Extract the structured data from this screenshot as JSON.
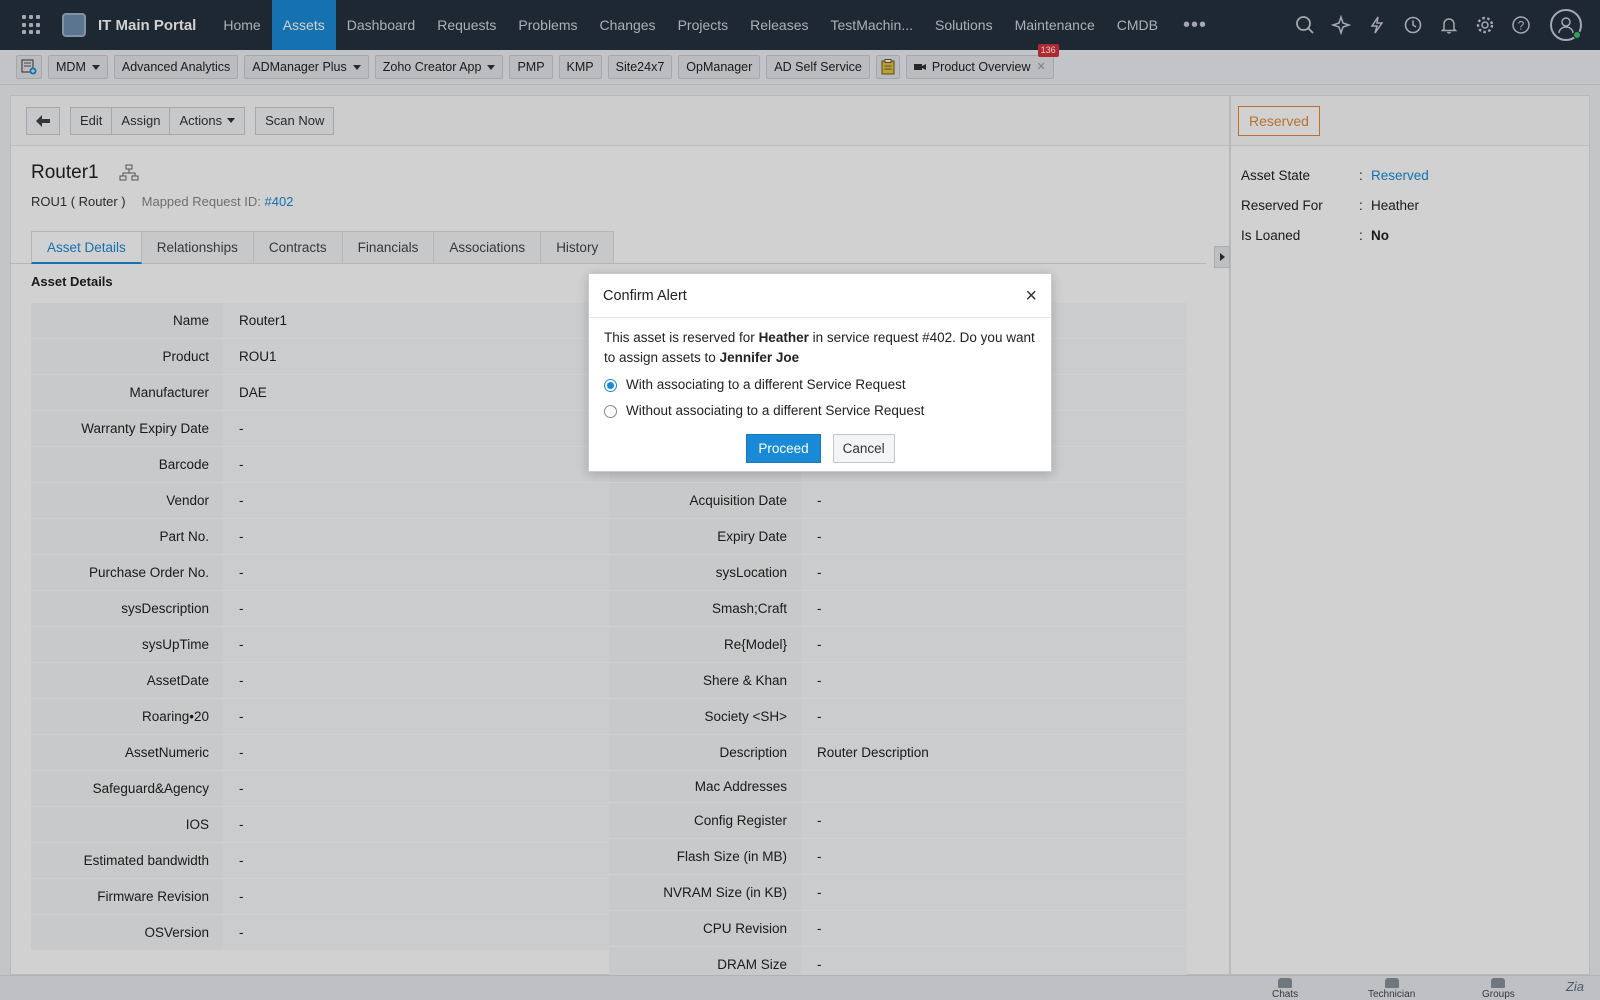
{
  "topnav": {
    "title": "IT Main Portal",
    "tabs": [
      {
        "label": "Home"
      },
      {
        "label": "Assets",
        "active": true
      },
      {
        "label": "Dashboard"
      },
      {
        "label": "Requests"
      },
      {
        "label": "Problems"
      },
      {
        "label": "Changes"
      },
      {
        "label": "Projects"
      },
      {
        "label": "Releases"
      },
      {
        "label": "TestMachin..."
      },
      {
        "label": "Solutions"
      },
      {
        "label": "Maintenance"
      },
      {
        "label": "CMDB"
      }
    ],
    "more": "•••",
    "icons": [
      "search-icon",
      "ai-sparkle-icon",
      "lightning-icon",
      "history-icon",
      "bell-icon",
      "gear-icon",
      "help-icon"
    ]
  },
  "toolbar": {
    "items": [
      {
        "label": "MDM",
        "dropdown": true
      },
      {
        "label": "Advanced Analytics"
      },
      {
        "label": "ADManager Plus",
        "dropdown": true
      },
      {
        "label": "Zoho Creator App",
        "dropdown": true
      },
      {
        "label": "PMP"
      },
      {
        "label": "KMP"
      },
      {
        "label": "Site24x7"
      },
      {
        "label": "OpManager"
      },
      {
        "label": "AD Self Service"
      }
    ],
    "product_overview": "Product Overview",
    "badge_count": "136"
  },
  "actionbar": {
    "edit": "Edit",
    "assign": "Assign",
    "actions": "Actions",
    "scan_now": "Scan Now"
  },
  "asset": {
    "title": "Router1",
    "subtitle": "ROU1 ( Router )",
    "mapped_label": "Mapped Request ID:",
    "mapped_id": "#402"
  },
  "tabs": [
    {
      "label": "Asset Details",
      "active": true
    },
    {
      "label": "Relationships"
    },
    {
      "label": "Contracts"
    },
    {
      "label": "Financials"
    },
    {
      "label": "Associations"
    },
    {
      "label": "History"
    }
  ],
  "section_title": "Asset Details",
  "details_left": [
    {
      "label": "Name",
      "value": "Router1"
    },
    {
      "label": "Product",
      "value": "ROU1"
    },
    {
      "label": "Manufacturer",
      "value": "DAE"
    },
    {
      "label": "Warranty Expiry Date",
      "value": "-"
    },
    {
      "label": "Barcode",
      "value": "-"
    },
    {
      "label": "Vendor",
      "value": "-"
    },
    {
      "label": "Part No.",
      "value": "-"
    },
    {
      "label": "Purchase Order No.",
      "value": "-"
    },
    {
      "label": "sysDescription",
      "value": "-"
    },
    {
      "label": "sysUpTime",
      "value": "-"
    },
    {
      "label": "AssetDate",
      "value": "-"
    },
    {
      "label": "Roaring•20",
      "value": "-"
    },
    {
      "label": "AssetNumeric",
      "value": "-"
    },
    {
      "label": "Safeguard&Agency",
      "value": "-"
    },
    {
      "label": "IOS",
      "value": "-"
    },
    {
      "label": "Estimated bandwidth",
      "value": "-"
    },
    {
      "label": "Firmware Revision",
      "value": "-"
    },
    {
      "label": "OSVersion",
      "value": "-"
    }
  ],
  "details_right": [
    {
      "label": "",
      "value": ""
    },
    {
      "label": "",
      "value": ""
    },
    {
      "label": "",
      "value": ""
    },
    {
      "label": "",
      "value": ""
    },
    {
      "label": "",
      "value": ""
    },
    {
      "label": "Acquisition Date",
      "value": "-"
    },
    {
      "label": "Expiry Date",
      "value": "-"
    },
    {
      "label": "sysLocation",
      "value": "-"
    },
    {
      "label": "Smash;Craft",
      "value": "-"
    },
    {
      "label": "Re{Model}",
      "value": "-"
    },
    {
      "label": "Shere & Khan",
      "value": "-"
    },
    {
      "label": "Society <SH>",
      "value": "-"
    },
    {
      "label": "Description",
      "value": "Router Description"
    },
    {
      "label": "Mac Addresses",
      "value": "",
      "short": true
    },
    {
      "label": "Config Register",
      "value": "-"
    },
    {
      "label": "Flash Size (in MB)",
      "value": "-"
    },
    {
      "label": "NVRAM Size (in KB)",
      "value": "-"
    },
    {
      "label": "CPU Revision",
      "value": "-"
    },
    {
      "label": "DRAM Size",
      "value": "-"
    }
  ],
  "side": {
    "state_badge": "Reserved",
    "rows": [
      {
        "key": "Asset State",
        "value": "Reserved",
        "link": true
      },
      {
        "key": "Reserved For",
        "value": "Heather"
      },
      {
        "key": "Is Loaned",
        "value": "No",
        "bold": true
      }
    ]
  },
  "dialog": {
    "title": "Confirm Alert",
    "msg_1": "This asset is reserved for ",
    "msg_name1": "Heather",
    "msg_2": " in service request #402. Do you want to assign assets to ",
    "msg_name2": "Jennifer Joe",
    "option_with": "With associating to a different Service Request",
    "option_without": "Without associating to a different  Service Request",
    "proceed": "Proceed",
    "cancel": "Cancel"
  },
  "bottombar": {
    "chats": "Chats",
    "technician": "Technician",
    "groups": "Groups",
    "zia": "Zia"
  },
  "colors": {
    "nav_bg": "#25313f",
    "accent": "#1a8ad6",
    "reserved": "#e08a3c"
  }
}
